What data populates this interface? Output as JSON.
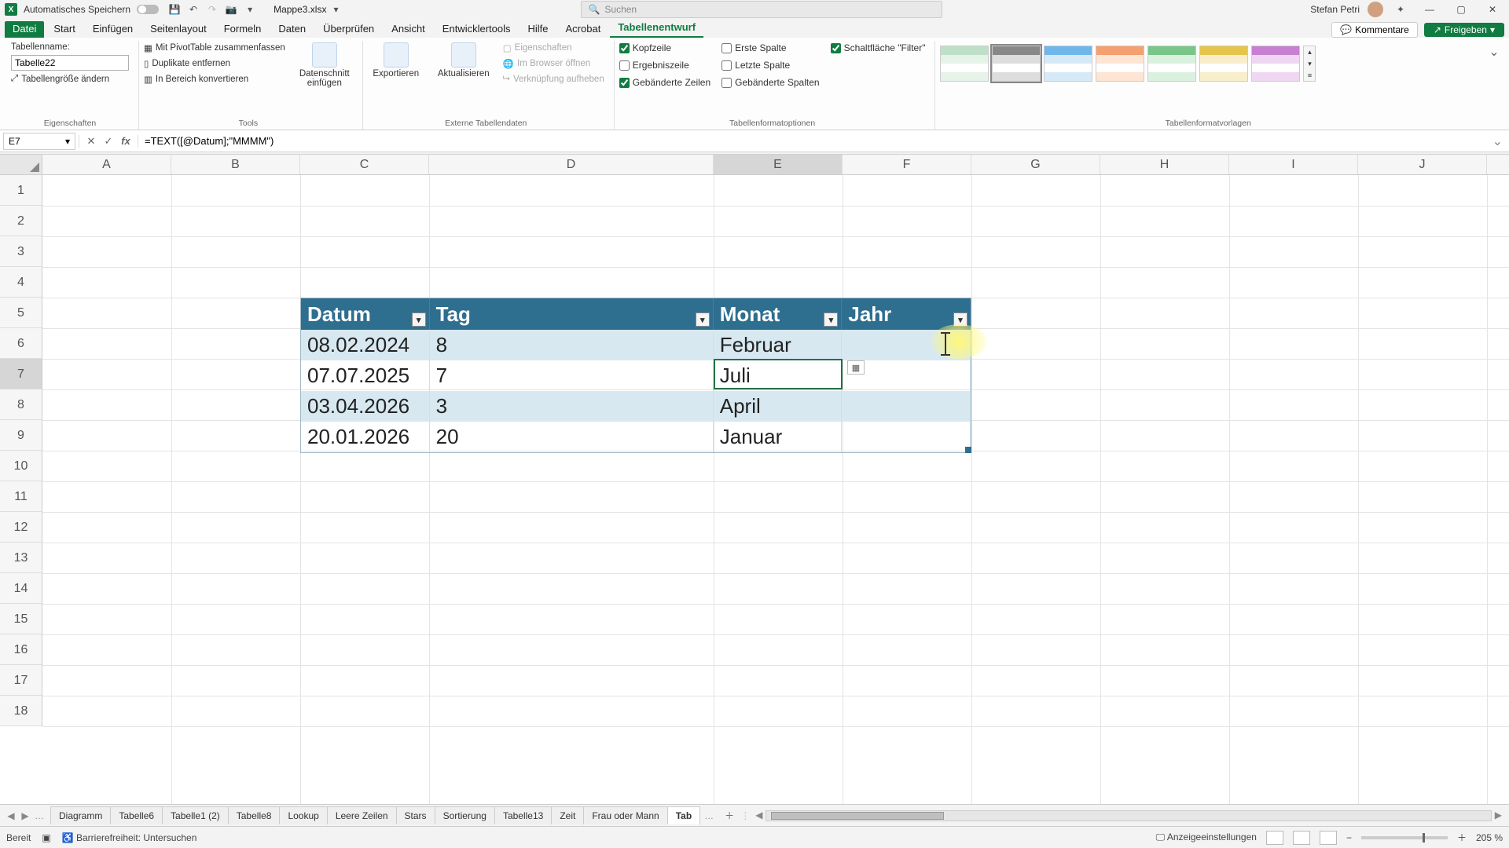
{
  "titlebar": {
    "autosave_label": "Automatisches Speichern",
    "filename": "Mappe3.xlsx",
    "search_placeholder": "Suchen",
    "username": "Stefan Petri"
  },
  "menu": {
    "items": [
      "Datei",
      "Start",
      "Einfügen",
      "Seitenlayout",
      "Formeln",
      "Daten",
      "Überprüfen",
      "Ansicht",
      "Entwicklertools",
      "Hilfe",
      "Acrobat",
      "Tabellenentwurf"
    ],
    "comments": "Kommentare",
    "share": "Freigeben"
  },
  "ribbon": {
    "g_props": {
      "label": "Eigenschaften",
      "name_label": "Tabellenname:",
      "table_name": "Tabelle22",
      "resize": "Tabellengröße ändern"
    },
    "g_tools": {
      "label": "Tools",
      "pivot": "Mit PivotTable zusammenfassen",
      "dedup": "Duplikate entfernen",
      "range": "In Bereich konvertieren",
      "slicer": "Datenschnitt einfügen"
    },
    "g_ext": {
      "label": "Externe Tabellendaten",
      "export": "Exportieren",
      "refresh": "Aktualisieren",
      "props": "Eigenschaften",
      "open": "Im Browser öffnen",
      "unlink": "Verknüpfung aufheben"
    },
    "g_opts": {
      "label": "Tabellenformatoptionen",
      "header": "Kopfzeile",
      "total": "Ergebniszeile",
      "banded_rows": "Gebänderte Zeilen",
      "first": "Erste Spalte",
      "last": "Letzte Spalte",
      "banded_cols": "Gebänderte Spalten",
      "filter": "Schaltfläche \"Filter\""
    },
    "g_styles": {
      "label": "Tabellenformatvorlagen"
    }
  },
  "fbar": {
    "cell_ref": "E7",
    "formula": "=TEXT([@Datum];\"MMMM\")"
  },
  "grid": {
    "columns": [
      "A",
      "B",
      "C",
      "D",
      "E",
      "F",
      "G",
      "H",
      "I",
      "J"
    ],
    "rows": [
      "1",
      "2",
      "3",
      "4",
      "5",
      "6",
      "7",
      "8",
      "9",
      "10",
      "11",
      "12",
      "13",
      "14",
      "15",
      "16",
      "17",
      "18"
    ]
  },
  "table": {
    "headers": {
      "c": "Datum",
      "d": "Tag",
      "e": "Monat",
      "f": "Jahr"
    },
    "rows": [
      {
        "c": "08.02.2024",
        "d": "8",
        "e": "Februar",
        "f": ""
      },
      {
        "c": "07.07.2025",
        "d": "7",
        "e": "Juli",
        "f": ""
      },
      {
        "c": "03.04.2026",
        "d": "3",
        "e": "April",
        "f": ""
      },
      {
        "c": "20.01.2026",
        "d": "20",
        "e": "Januar",
        "f": ""
      }
    ]
  },
  "sheets": {
    "tabs": [
      "Diagramm",
      "Tabelle6",
      "Tabelle1 (2)",
      "Tabelle8",
      "Lookup",
      "Leere Zeilen",
      "Stars",
      "Sortierung",
      "Tabelle13",
      "Zeit",
      "Frau oder Mann",
      "Tab"
    ]
  },
  "status": {
    "ready": "Bereit",
    "a11y": "Barrierefreiheit: Untersuchen",
    "display": "Anzeigeeinstellungen",
    "zoom": "205 %"
  }
}
